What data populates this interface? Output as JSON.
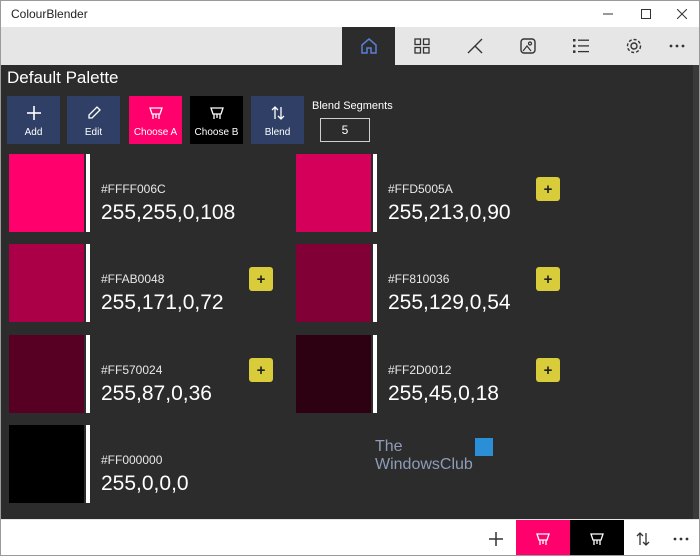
{
  "window": {
    "title": "ColourBlender"
  },
  "nav": {
    "items": [
      {
        "icon": "home-icon",
        "active": true
      },
      {
        "icon": "grid-icon",
        "active": false
      },
      {
        "icon": "blend-icon",
        "active": false
      },
      {
        "icon": "image-icon",
        "active": false
      },
      {
        "icon": "list-icon",
        "active": false
      },
      {
        "icon": "gear-icon",
        "active": false
      }
    ]
  },
  "palette": {
    "title": "Default Palette"
  },
  "toolbar": {
    "add_label": "Add",
    "edit_label": "Edit",
    "choose_a_label": "Choose A",
    "choose_b_label": "Choose B",
    "blend_label": "Blend",
    "segments_label": "Blend Segments",
    "segments_value": "5"
  },
  "colors": [
    {
      "hex": "#FFFF006C",
      "rgb": "255,255,0,108",
      "swatch": "#ff006c",
      "has_add": false
    },
    {
      "hex": "#FFD5005A",
      "rgb": "255,213,0,90",
      "swatch": "#d5005a",
      "has_add": true
    },
    {
      "hex": "#FFAB0048",
      "rgb": "255,171,0,72",
      "swatch": "#ab0048",
      "has_add": true
    },
    {
      "hex": "#FF810036",
      "rgb": "255,129,0,54",
      "swatch": "#810036",
      "has_add": true
    },
    {
      "hex": "#FF570024",
      "rgb": "255,87,0,36",
      "swatch": "#570024",
      "has_add": true
    },
    {
      "hex": "#FF2D0012",
      "rgb": "255,45,0,18",
      "swatch": "#2d0012",
      "has_add": true
    },
    {
      "hex": "#FF000000",
      "rgb": "255,0,0,0",
      "swatch": "#000000",
      "has_add": false
    }
  ],
  "add_symbol": "+",
  "watermark": {
    "line1": "The",
    "line2": "WindowsClub"
  },
  "colors_theme": {
    "accent": "#ff006c",
    "chip": "#d8cc3a",
    "nav_active": "#2c2c2c"
  }
}
